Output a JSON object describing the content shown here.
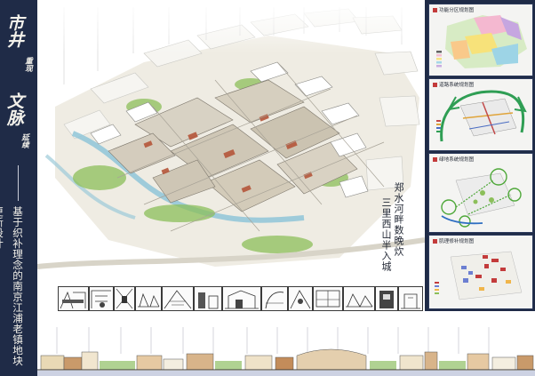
{
  "title": {
    "line1": "市井",
    "line1_small": "重现",
    "line2": "文脉",
    "line2_small": "延续",
    "subtitle": "基于织补理念的南京江浦老镇地块更新设计"
  },
  "poem": {
    "col1": "郑水河畔数晚炊",
    "col2": "三里西山半入城"
  },
  "panels": [
    {
      "title": "功能分区规划图",
      "icon": "red-square-icon"
    },
    {
      "title": "道路系统规划图",
      "icon": "red-square-icon"
    },
    {
      "title": "绿地系统规划图",
      "icon": "red-square-icon"
    },
    {
      "title": "肌理修补规划图",
      "icon": "red-square-icon"
    }
  ],
  "colors": {
    "sidebar": "#1f2b47",
    "title_text": "#f3f1ea",
    "panel_mark": "#c33b3b",
    "water": "#8fc6d8",
    "roof_red": "#b5563a",
    "green": "#8cbf5a"
  }
}
